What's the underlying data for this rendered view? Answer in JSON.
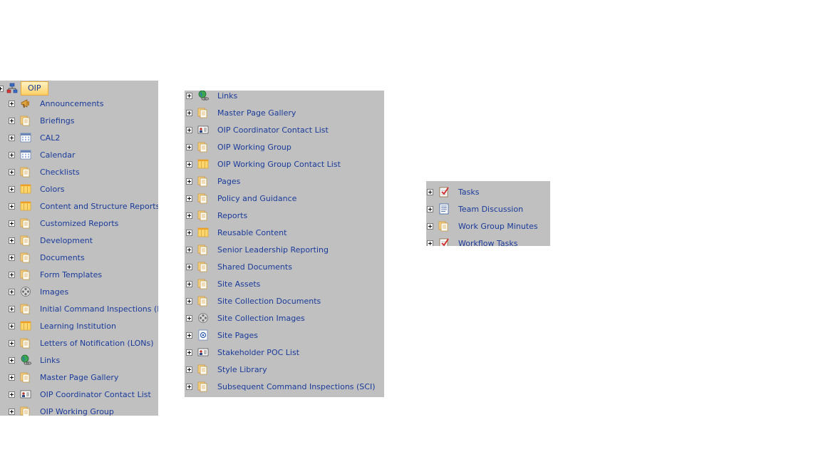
{
  "root": {
    "label": "OIP",
    "icon": "site-hierarchy-icon"
  },
  "panel1": [
    {
      "label": "Announcements",
      "icon": "megaphone-icon"
    },
    {
      "label": "Briefings",
      "icon": "document-library-icon"
    },
    {
      "label": "CAL2",
      "icon": "calendar-icon"
    },
    {
      "label": "Calendar",
      "icon": "calendar-icon"
    },
    {
      "label": "Checklists",
      "icon": "document-library-icon"
    },
    {
      "label": "Colors",
      "icon": "custom-list-icon"
    },
    {
      "label": "Content and Structure Reports",
      "icon": "custom-list-icon"
    },
    {
      "label": "Customized Reports",
      "icon": "document-library-icon"
    },
    {
      "label": "Development",
      "icon": "document-library-icon"
    },
    {
      "label": "Documents",
      "icon": "document-library-icon"
    },
    {
      "label": "Form Templates",
      "icon": "document-library-icon"
    },
    {
      "label": "Images",
      "icon": "picture-library-icon"
    },
    {
      "label": "Initial Command Inspections (ICI)",
      "icon": "document-library-icon"
    },
    {
      "label": "Learning Institution",
      "icon": "custom-list-icon"
    },
    {
      "label": "Letters of Notification (LONs)",
      "icon": "document-library-icon"
    },
    {
      "label": "Links",
      "icon": "links-globe-icon"
    },
    {
      "label": "Master Page Gallery",
      "icon": "document-library-icon"
    },
    {
      "label": "OIP Coordinator Contact List",
      "icon": "contacts-icon"
    },
    {
      "label": "OIP Working Group",
      "icon": "document-library-icon"
    }
  ],
  "panel2": [
    {
      "label": "Links",
      "icon": "links-globe-icon"
    },
    {
      "label": "Master Page Gallery",
      "icon": "document-library-icon"
    },
    {
      "label": "OIP Coordinator Contact List",
      "icon": "contacts-icon"
    },
    {
      "label": "OIP Working Group",
      "icon": "document-library-icon"
    },
    {
      "label": "OIP Working Group Contact List",
      "icon": "custom-list-icon"
    },
    {
      "label": "Pages",
      "icon": "document-library-icon"
    },
    {
      "label": "Policy and Guidance",
      "icon": "document-library-icon"
    },
    {
      "label": "Reports",
      "icon": "document-library-icon"
    },
    {
      "label": "Reusable Content",
      "icon": "custom-list-icon"
    },
    {
      "label": "Senior Leadership Reporting",
      "icon": "document-library-icon"
    },
    {
      "label": "Shared Documents",
      "icon": "document-library-icon"
    },
    {
      "label": "Site Assets",
      "icon": "document-library-icon"
    },
    {
      "label": "Site Collection Documents",
      "icon": "document-library-icon"
    },
    {
      "label": "Site Collection Images",
      "icon": "picture-library-icon"
    },
    {
      "label": "Site Pages",
      "icon": "wiki-pages-icon"
    },
    {
      "label": "Stakeholder POC List",
      "icon": "contacts-icon"
    },
    {
      "label": "Style Library",
      "icon": "document-library-icon"
    },
    {
      "label": "Subsequent Command Inspections (SCI)",
      "icon": "document-library-icon"
    }
  ],
  "panel3": [
    {
      "label": "Tasks",
      "icon": "tasks-icon"
    },
    {
      "label": "Team Discussion",
      "icon": "discussion-icon"
    },
    {
      "label": "Work Group Minutes",
      "icon": "document-library-icon"
    },
    {
      "label": "Workflow Tasks",
      "icon": "tasks-icon"
    }
  ]
}
